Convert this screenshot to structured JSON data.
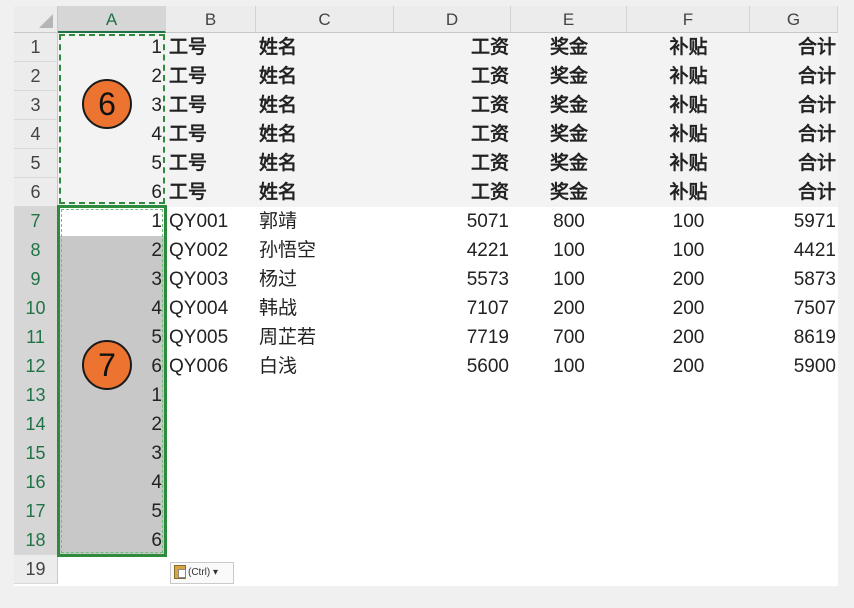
{
  "columns": [
    "A",
    "B",
    "C",
    "D",
    "E",
    "F",
    "G"
  ],
  "rows": [
    "1",
    "2",
    "3",
    "4",
    "5",
    "6",
    "7",
    "8",
    "9",
    "10",
    "11",
    "12",
    "13",
    "14",
    "15",
    "16",
    "17",
    "18",
    "19"
  ],
  "header_row": {
    "b": "工号",
    "c": "姓名",
    "d": "工资",
    "e": "奖金",
    "f": "补贴",
    "g": "合计"
  },
  "col_a": [
    "1",
    "2",
    "3",
    "4",
    "5",
    "6",
    "1",
    "2",
    "3",
    "4",
    "5",
    "6",
    "1",
    "2",
    "3",
    "4",
    "5",
    "6"
  ],
  "data_rows": [
    {
      "b": "QY001",
      "c": "郭靖",
      "d": "5071",
      "e": "800",
      "f": "100",
      "g": "5971"
    },
    {
      "b": "QY002",
      "c": "孙悟空",
      "d": "4221",
      "e": "100",
      "f": "100",
      "g": "4421"
    },
    {
      "b": "QY003",
      "c": "杨过",
      "d": "5573",
      "e": "100",
      "f": "200",
      "g": "5873"
    },
    {
      "b": "QY004",
      "c": "韩战",
      "d": "7107",
      "e": "200",
      "f": "200",
      "g": "7507"
    },
    {
      "b": "QY005",
      "c": "周芷若",
      "d": "7719",
      "e": "700",
      "f": "200",
      "g": "8619"
    },
    {
      "b": "QY006",
      "c": "白浅",
      "d": "5600",
      "e": "100",
      "f": "200",
      "g": "5900"
    }
  ],
  "badges": {
    "first": "6",
    "second": "7"
  },
  "paste_options": {
    "label": "(Ctrl) ▾"
  },
  "colors": {
    "selection": "#2e8b3e",
    "badge": "#ec7330",
    "fill": "#c9c8c8"
  }
}
